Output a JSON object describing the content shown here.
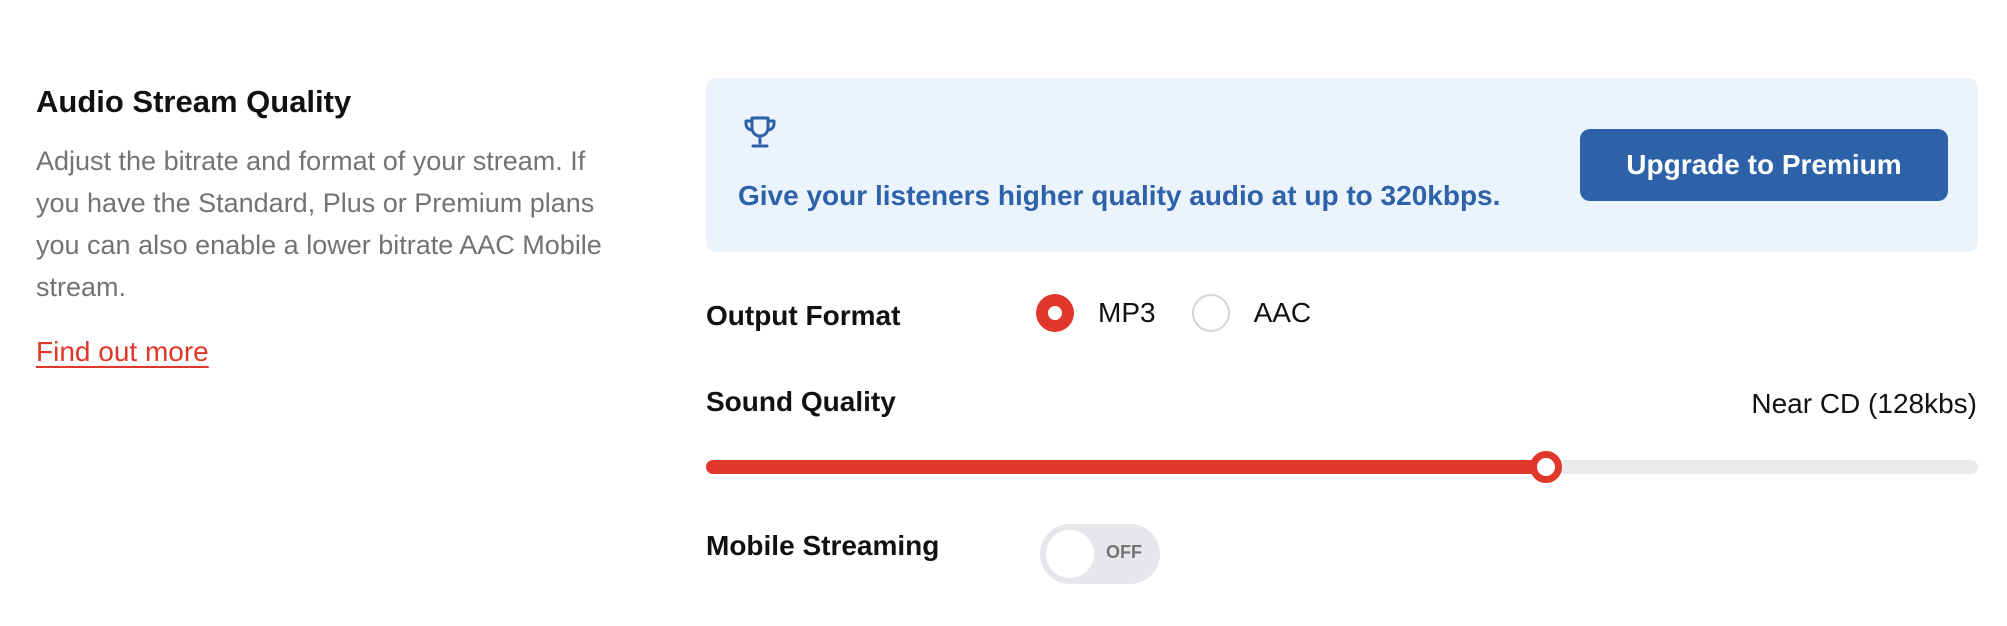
{
  "section": {
    "title": "Audio Stream Quality",
    "description": "Adjust the bitrate and format of your stream. If you have the Standard, Plus or Premium plans you can also enable a lower bitrate AAC Mobile stream.",
    "link_label": "Find out more"
  },
  "banner": {
    "icon": "trophy-icon",
    "message": "Give your listeners higher quality audio at up to 320kbps.",
    "button_label": "Upgrade to Premium"
  },
  "output_format": {
    "label": "Output Format",
    "options": [
      {
        "label": "MP3",
        "selected": true
      },
      {
        "label": "AAC",
        "selected": false
      }
    ]
  },
  "sound_quality": {
    "label": "Sound Quality",
    "value_label": "Near CD (128kbs)",
    "level_fraction": 0.66
  },
  "mobile_streaming": {
    "label": "Mobile Streaming",
    "state_label": "OFF",
    "enabled": false
  },
  "colors": {
    "accent": "#e1372a",
    "brand_blue": "#2d62a8",
    "banner_bg": "#ebf3fd",
    "muted_text": "#737373"
  }
}
